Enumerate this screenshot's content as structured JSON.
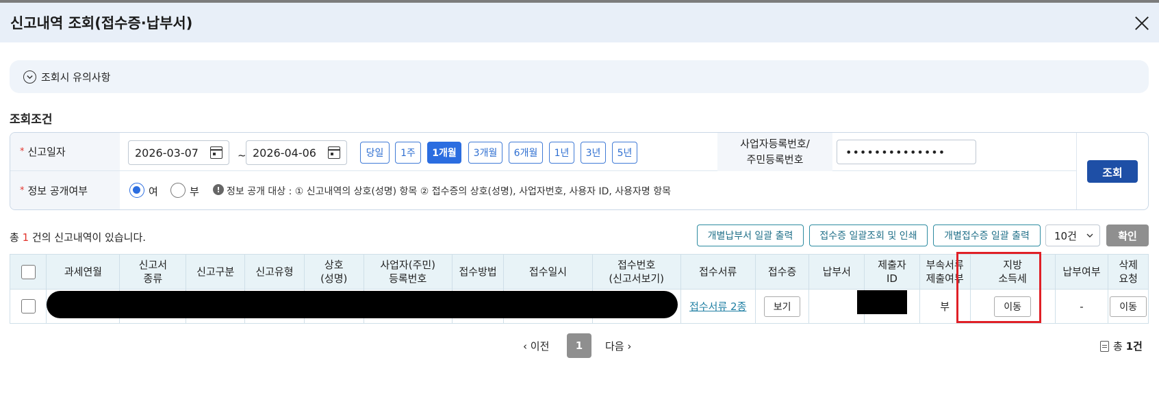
{
  "dialog": {
    "title": "신고내역 조회(접수증·납부서)"
  },
  "notice": {
    "label": "조회시 유의사항"
  },
  "section": {
    "title": "조회조건"
  },
  "conditions": {
    "date_label": "신고일자",
    "date_from": "2026-03-07",
    "date_to": "2026-04-06",
    "range_sep": "~",
    "periods": [
      "당일",
      "1주",
      "1개월",
      "3개월",
      "6개월",
      "1년",
      "3년",
      "5년"
    ],
    "active_period": "1개월",
    "biz_label_1": "사업자등록번호/",
    "biz_label_2": "주민등록번호",
    "biz_value": "••••••••••••••",
    "disclose_label": "정보 공개여부",
    "disclose_yes": "여",
    "disclose_no": "부",
    "disclose_selected": "여",
    "info_mark": "!",
    "info_text": "정보 공개 대상 : ① 신고내역의 상호(성명) 항목 ② 접수증의 상호(성명), 사업자번호, 사용자 ID, 사용자명 항목",
    "search_label": "조회"
  },
  "results": {
    "total_prefix": "총",
    "total_count": "1",
    "total_suffix": "건의 신고내역이 있습니다.",
    "btn_payment_print": "개별납부서 일괄 출력",
    "btn_receipt_view": "접수증 일괄조회 및 인쇄",
    "btn_receipt_print": "개별접수증 일괄 출력",
    "per_page": "10건",
    "confirm": "확인"
  },
  "table": {
    "headers": [
      [
        "과세연월"
      ],
      [
        "신고서",
        "종류"
      ],
      [
        "신고구분"
      ],
      [
        "신고유형"
      ],
      [
        "상호",
        "(성명)"
      ],
      [
        "사업자(주민)",
        "등록번호"
      ],
      [
        "접수방법"
      ],
      [
        "접수일시"
      ],
      [
        "접수번호",
        "(신고서보기)"
      ],
      [
        "접수서류"
      ],
      [
        "접수증"
      ],
      [
        "납부서"
      ],
      [
        "제출자",
        "ID"
      ],
      [
        "부속서류",
        "제출여부"
      ],
      [
        "지방",
        "소득세"
      ],
      [
        "납부여부"
      ],
      [
        "삭제",
        "요청"
      ]
    ],
    "row": {
      "docs_link": "접수서류 2종",
      "receipt_btn": "보기",
      "attach": "부",
      "local_tax_btn": "이동",
      "paid": "-",
      "delete_btn": "이동"
    }
  },
  "pager": {
    "prev": "이전",
    "current": "1",
    "next": "다음"
  },
  "footer": {
    "total_label": "총",
    "total_value": "1건"
  },
  "colors": {
    "accent": "#2b6de0",
    "search": "#1e4fa6",
    "highlight": "#e01f26",
    "header_bg": "#e8f3f7"
  }
}
